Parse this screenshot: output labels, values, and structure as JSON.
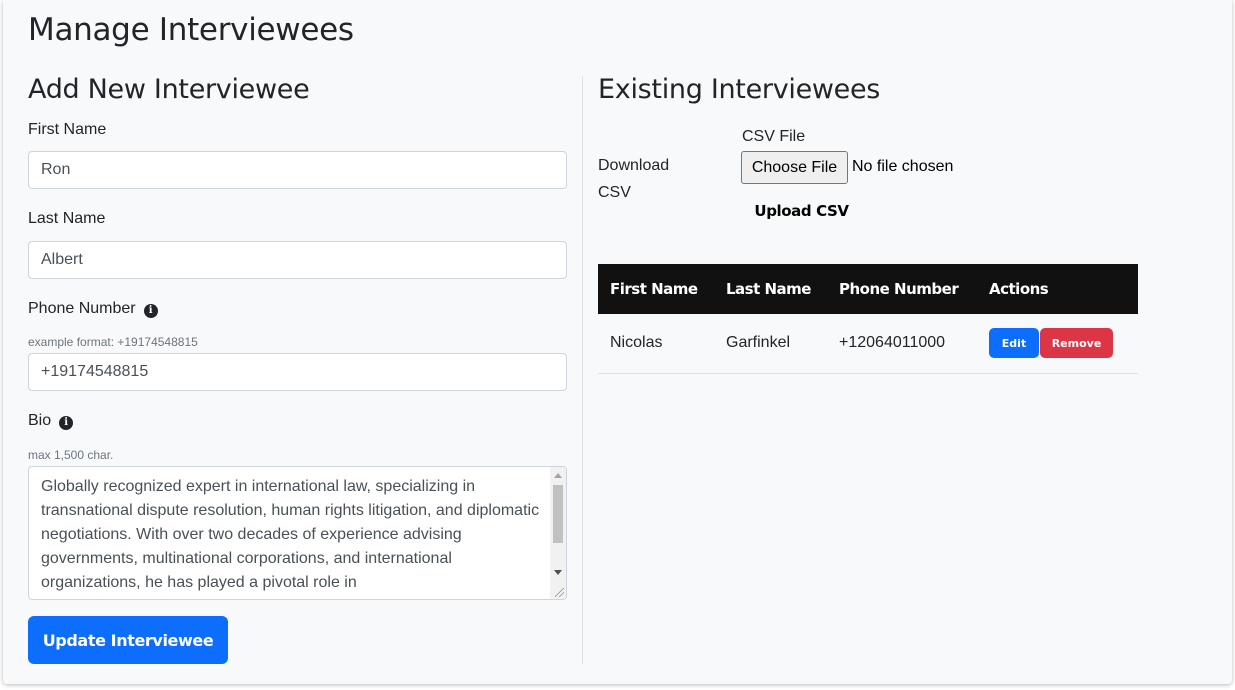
{
  "page": {
    "title": "Manage Interviewees"
  },
  "form": {
    "title": "Add New Interviewee",
    "first_name": {
      "label": "First Name",
      "value": "Ron"
    },
    "last_name": {
      "label": "Last Name",
      "value": "Albert"
    },
    "phone": {
      "label": "Phone Number",
      "help": "example format: +19174548815",
      "value": "+19174548815"
    },
    "bio": {
      "label": "Bio",
      "help": "max 1,500 char.",
      "value": "Globally recognized expert in international law, specializing in transnational dispute resolution, human rights litigation, and diplomatic negotiations. With over two decades of experience advising governments, multinational corporations, and international organizations, he has played a pivotal role in"
    },
    "submit_label": "Update Interviewee"
  },
  "existing": {
    "title": "Existing Interviewees",
    "download_csv": "Download CSV",
    "csv_file_label": "CSV File",
    "choose_file": "Choose File",
    "no_file": "No file chosen",
    "upload_csv": "Upload CSV",
    "table": {
      "headers": [
        "First Name",
        "Last Name",
        "Phone Number",
        "Actions"
      ],
      "rows": [
        {
          "first": "Nicolas",
          "last": "Garfinkel",
          "phone": "+12064011000",
          "edit": "Edit",
          "remove": "Remove"
        }
      ]
    }
  },
  "colors": {
    "primary": "#0d6efd",
    "danger": "#dc3545",
    "header_bg": "#111111",
    "card_bg": "#f8f9fa"
  }
}
